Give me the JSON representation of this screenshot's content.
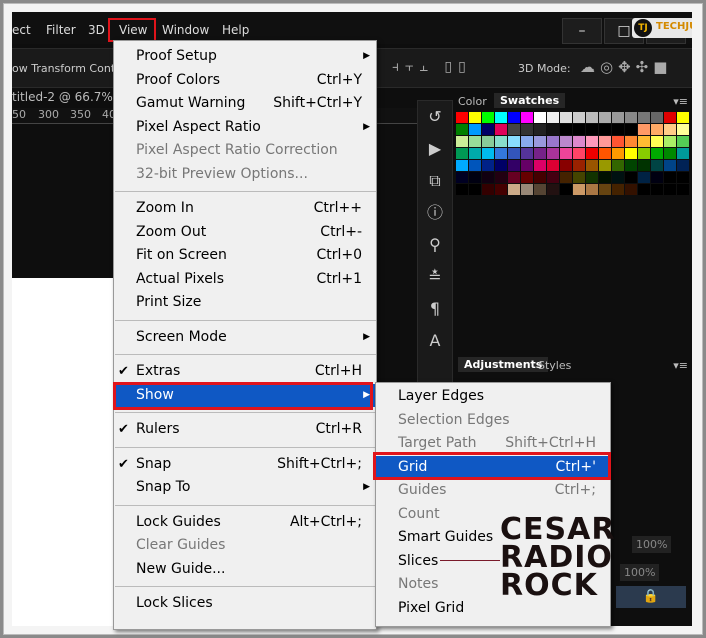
{
  "menubar": {
    "items": [
      "ect",
      "Filter",
      "3D",
      "View",
      "Window",
      "Help"
    ],
    "active": "View"
  },
  "window_buttons": [
    "–",
    "□",
    "✕"
  ],
  "logos": {
    "techjunkie": "TECHJUNKIE",
    "techjunkie_mark": "TJ",
    "watermark": "CESAR RADIO ROCK"
  },
  "options_bar": {
    "transform": "ow Transform Contr",
    "mode_label": "3D Mode:"
  },
  "document": {
    "title": "titled-2 @ 66.7% (",
    "ruler": [
      "50",
      "300",
      "350",
      "40"
    ]
  },
  "panel": {
    "tabs": [
      "Color",
      "Swatches"
    ],
    "active_tab": "Swatches",
    "tabs2": [
      "Adjustments",
      "Styles"
    ],
    "active_tab2": "Adjustments",
    "opacity": "100%",
    "fill": "100%"
  },
  "swatch_rows": [
    [
      "#ff0000",
      "#ffff00",
      "#00ff00",
      "#00ffff",
      "#0000ff",
      "#ff00ff",
      "#ffffff",
      "#eeeeee",
      "#dddddd",
      "#cccccc",
      "#bbbbbb",
      "#aaaaaa",
      "#999999",
      "#888888",
      "#777777",
      "#666666",
      "#e00000",
      "#ffff00"
    ],
    [
      "#008000",
      "#0099ff",
      "#000066",
      "#e0005a",
      "#444444",
      "#333333",
      "#222222",
      "#111111",
      "#000000",
      "#000000",
      "#000000",
      "#000000",
      "#000000",
      "#000000",
      "#ff9966",
      "#ffaa66",
      "#ffcc88",
      "#ffff99"
    ],
    [
      "#ccee99",
      "#99dd99",
      "#88cc99",
      "#88ddcc",
      "#88ddff",
      "#88aaee",
      "#9999dd",
      "#9977cc",
      "#bb88cc",
      "#dd88cc",
      "#ff99bb",
      "#ff9999",
      "#ff5533",
      "#ff8833",
      "#ffbb33",
      "#ffff55",
      "#aaee66",
      "#55cc55"
    ],
    [
      "#009955",
      "#00aaaa",
      "#00bbee",
      "#3377dd",
      "#3355bb",
      "#553399",
      "#772288",
      "#aa3399",
      "#ee4499",
      "#ff4466",
      "#ee0000",
      "#ff5500",
      "#ff9900",
      "#ffff00",
      "#88cc00",
      "#00aa00",
      "#008800",
      "#009999"
    ],
    [
      "#00aaff",
      "#0055bb",
      "#002288",
      "#000066",
      "#330066",
      "#660066",
      "#dd0066",
      "#dd0033",
      "#880000",
      "#992200",
      "#995500",
      "#999900",
      "#336600",
      "#004400",
      "#003300",
      "#004444",
      "#004488",
      "#002255"
    ],
    [
      "#000022",
      "#000011",
      "#110011",
      "#220011",
      "#660022",
      "#660000",
      "#440000",
      "#440011",
      "#442200",
      "#444400",
      "#113300",
      "#001100",
      "#001111",
      "#000000",
      "#002244",
      "#000011",
      "#000000",
      "#000000"
    ],
    [
      "#000000",
      "#000000",
      "#330000",
      "#440000",
      "#ccaa88",
      "#998877",
      "#554433",
      "#221111",
      "#000000",
      "#cc9966",
      "#aa7744",
      "#664411",
      "#442200",
      "#331100",
      "#000000",
      "#000000",
      "#000000",
      "#000000"
    ]
  ],
  "view_menu": [
    {
      "label": "Proof Setup",
      "sub": true
    },
    {
      "label": "Proof Colors",
      "shortcut": "Ctrl+Y"
    },
    {
      "label": "Gamut Warning",
      "shortcut": "Shift+Ctrl+Y"
    },
    {
      "label": "Pixel Aspect Ratio",
      "sub": true
    },
    {
      "label": "Pixel Aspect Ratio Correction",
      "disabled": true
    },
    {
      "label": "32-bit Preview Options...",
      "disabled": true
    },
    {
      "sep": true
    },
    {
      "label": "Zoom In",
      "shortcut": "Ctrl++"
    },
    {
      "label": "Zoom Out",
      "shortcut": "Ctrl+-"
    },
    {
      "label": "Fit on Screen",
      "shortcut": "Ctrl+0"
    },
    {
      "label": "Actual Pixels",
      "shortcut": "Ctrl+1"
    },
    {
      "label": "Print Size"
    },
    {
      "sep": true
    },
    {
      "label": "Screen Mode",
      "sub": true
    },
    {
      "sep": true
    },
    {
      "label": "Extras",
      "shortcut": "Ctrl+H",
      "checked": true
    },
    {
      "label": "Show",
      "sub": true,
      "selected": true
    },
    {
      "sep": true
    },
    {
      "label": "Rulers",
      "shortcut": "Ctrl+R",
      "checked": true
    },
    {
      "sep": true
    },
    {
      "label": "Snap",
      "shortcut": "Shift+Ctrl+;",
      "checked": true
    },
    {
      "label": "Snap To",
      "sub": true
    },
    {
      "sep": true
    },
    {
      "label": "Lock Guides",
      "shortcut": "Alt+Ctrl+;"
    },
    {
      "label": "Clear Guides",
      "disabled": true
    },
    {
      "label": "New Guide..."
    },
    {
      "sep": true
    },
    {
      "label": "Lock Slices"
    }
  ],
  "show_menu": [
    {
      "label": "Layer Edges"
    },
    {
      "label": "Selection Edges",
      "disabled": true
    },
    {
      "label": "Target Path",
      "shortcut": "Shift+Ctrl+H",
      "disabled": true
    },
    {
      "label": "Grid",
      "shortcut": "Ctrl+'",
      "selected": true
    },
    {
      "label": "Guides",
      "shortcut": "Ctrl+;",
      "disabled": true
    },
    {
      "label": "Count",
      "disabled": true
    },
    {
      "label": "Smart Guides"
    },
    {
      "label": "Slices"
    },
    {
      "label": "Notes",
      "disabled": true
    },
    {
      "label": "Pixel Grid"
    }
  ],
  "colors": {
    "highlight": "#0f58c4",
    "annotation": "#e0141b"
  }
}
